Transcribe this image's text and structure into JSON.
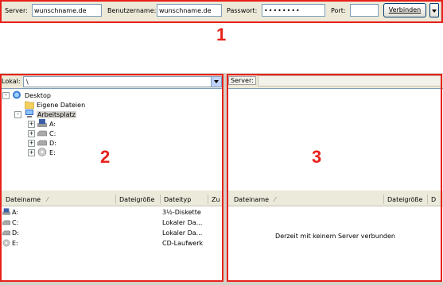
{
  "quickconnect": {
    "server_label": "Server:",
    "server_value": "wunschname.de",
    "username_label": "Benutzername:",
    "username_value": "wunschname.de",
    "password_label": "Passwort:",
    "password_value": "••••••••",
    "port_label": "Port:",
    "port_value": "",
    "connect_label": "Verbinden"
  },
  "local": {
    "label": "Lokal:",
    "path": "\\",
    "tree": [
      {
        "label": "Desktop",
        "icon": "desktop-icon",
        "expander": "-"
      },
      {
        "label": "Eigene Dateien",
        "icon": "folder-icon",
        "expander": ""
      },
      {
        "label": "Arbeitsplatz",
        "icon": "computer-icon",
        "expander": "-",
        "selected": true
      },
      {
        "label": "A:",
        "icon": "floppy-drive-icon",
        "expander": "+"
      },
      {
        "label": "C:",
        "icon": "hard-drive-icon",
        "expander": "+"
      },
      {
        "label": "D:",
        "icon": "hard-drive-icon",
        "expander": "+"
      },
      {
        "label": "E:",
        "icon": "cd-drive-icon",
        "expander": "+"
      }
    ],
    "columns": [
      "Dateiname",
      "Dateigröße",
      "Dateityp",
      "Zu"
    ],
    "files": [
      {
        "name": "A:",
        "type": "3½-Diskette",
        "icon": "floppy-drive-icon"
      },
      {
        "name": "C:",
        "type": "Lokaler Da...",
        "icon": "hard-drive-icon"
      },
      {
        "name": "D:",
        "type": "Lokaler Da...",
        "icon": "hard-drive-icon"
      },
      {
        "name": "E:",
        "type": "CD-Laufwerk",
        "icon": "cd-drive-icon"
      }
    ]
  },
  "remote": {
    "label": "Server:",
    "columns": [
      "Dateiname",
      "Dateigröße",
      "D"
    ],
    "empty_message": "Derzeit mit keinem Server verbunden"
  },
  "annotations": [
    "1",
    "2",
    "3"
  ],
  "colors": {
    "annotation": "#e8201a"
  }
}
